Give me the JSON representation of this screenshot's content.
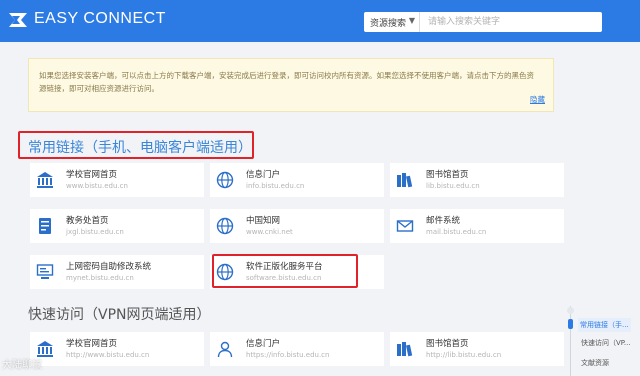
{
  "header": {
    "brand": "EASY CONNECT",
    "search_scope": "资源搜索",
    "search_placeholder": "请输入搜索关键字"
  },
  "notice": {
    "text": "如果您选择安装客户端，可以点击上方的下载客户端，安装完成后进行登录，即可访问校内所有资源。如果您选择不使用客户端，请点击下方的黑色资源链接，即可对相应资源进行访问。",
    "link": "隐藏"
  },
  "section1": {
    "title": "常用链接（手机、电脑客户端适用）",
    "cards": [
      {
        "name": "学校官网首页",
        "url": "www.bistu.edu.cn",
        "icon": "bank-icon"
      },
      {
        "name": "信息门户",
        "url": "info.bistu.edu.cn",
        "icon": "globe-icon"
      },
      {
        "name": "图书馆首页",
        "url": "lib.bistu.edu.cn",
        "icon": "books-icon"
      },
      {
        "name": "教务处首页",
        "url": "jxgl.bistu.edu.cn",
        "icon": "document-icon"
      },
      {
        "name": "中国知网",
        "url": "www.cnki.net",
        "icon": "globe-icon"
      },
      {
        "name": "邮件系统",
        "url": "mail.bistu.edu.cn",
        "icon": "mail-icon"
      },
      {
        "name": "上网密码自助修改系统",
        "url": "mynet.bistu.edu.cn",
        "icon": "monitor-icon"
      },
      {
        "name": "软件正版化服务平台",
        "url": "software.bistu.edu.cn",
        "icon": "globe-icon"
      }
    ]
  },
  "section2": {
    "title": "快速访问（VPN网页端适用）",
    "cards": [
      {
        "name": "学校官网首页",
        "url": "http://www.bistu.edu.cn",
        "icon": "bank-icon"
      },
      {
        "name": "信息门户",
        "url": "https://info.bistu.edu.cn",
        "icon": "users-icon"
      },
      {
        "name": "图书馆首页",
        "url": "http://lib.bistu.edu.cn",
        "icon": "books-icon"
      }
    ]
  },
  "sidenav": {
    "items": [
      "常用链接（手...",
      "快速访问（VP...",
      "文献资源"
    ]
  },
  "watermark": "大陆聊鼠",
  "colors": {
    "header": "#2c7be5",
    "highlight": "#e0232b",
    "icon": "#2c6fc9"
  }
}
